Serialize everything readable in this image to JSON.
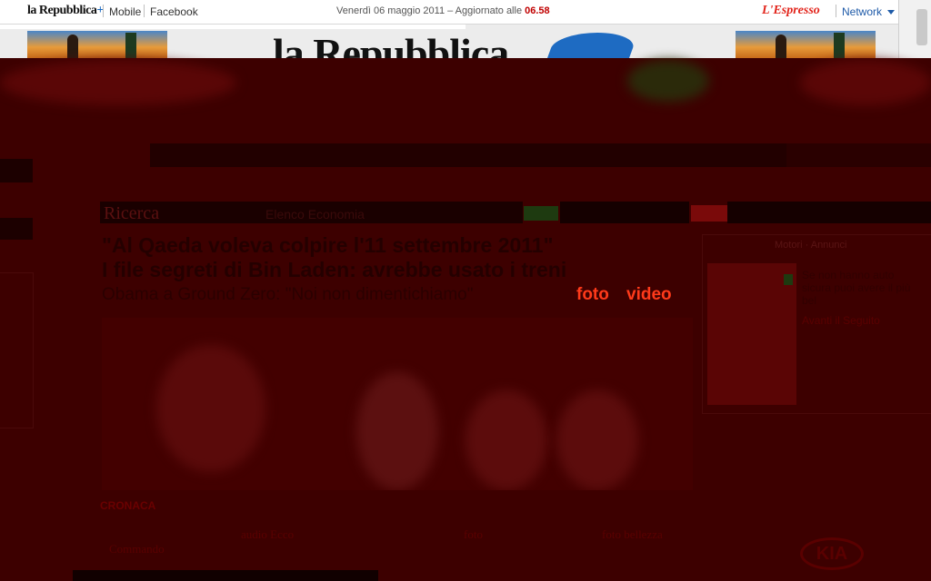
{
  "topbar": {
    "brand": "la Repubblica",
    "brand_plus": "+",
    "mobile": "Mobile",
    "facebook": "Facebook",
    "date_text": "Venerdì 06 maggio 2011 – Aggiornato alle",
    "update_time": "06.58",
    "espresso": "L'Espresso",
    "network": "Network"
  },
  "header": {
    "logo_text": "la Repubblica"
  },
  "section": {
    "head": "Ricerca",
    "sub": "Elenco Economia"
  },
  "article": {
    "headline_line1": "\"Al Qaeda voleva colpire l'11 settembre 2011\"",
    "headline_line2": "I file segreti di Bin Laden: avrebbe usato i treni",
    "summary": "Obama a Ground Zero: \"Noi non dimentichiamo\"",
    "foto": "foto",
    "video": "video"
  },
  "sidebox": {
    "title": "Motori · Annunci",
    "text": "Se non hanno auto sicura puoi avere il più bel",
    "link": "Avanti il Seguito"
  },
  "cronaca": {
    "label": "CRONACA",
    "text": ""
  },
  "bottom_links": {
    "audio": "audio Ecco",
    "foto": "foto",
    "foto_bellezza": "foto bellezza",
    "commando": "Commando"
  },
  "ad": {
    "kia": "KIA"
  },
  "colors": {
    "overlay": "#3d0000",
    "accent_red": "#ff3a1a",
    "brand_blue": "#1e6bc2"
  }
}
